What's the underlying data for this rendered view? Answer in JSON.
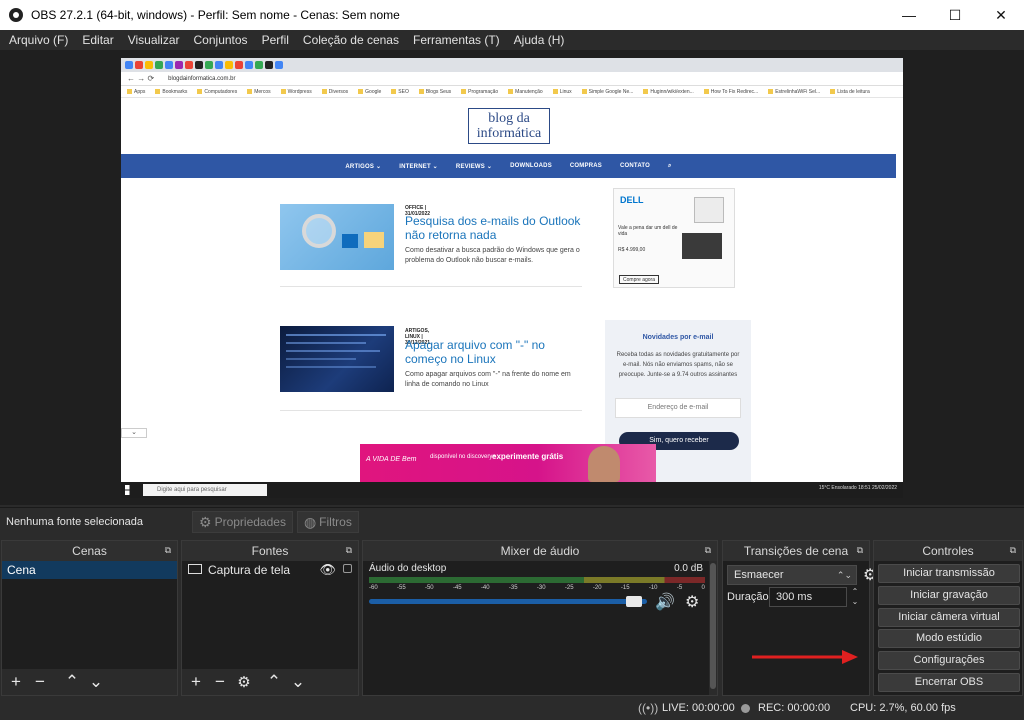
{
  "window": {
    "title": "OBS 27.2.1 (64-bit, windows) - Perfil: Sem nome - Cenas: Sem nome",
    "minimize": "—",
    "maximize": "☐",
    "close": "✕"
  },
  "menu": [
    "Arquivo (F)",
    "Editar",
    "Visualizar",
    "Conjuntos",
    "Perfil",
    "Coleção de cenas",
    "Ferramentas (T)",
    "Ajuda (H)"
  ],
  "preview": {
    "url": "blogdainformatica.com.br",
    "bookmarks": [
      "Apps",
      "Bookmarks",
      "Computadores",
      "Mercos",
      "Wordpress",
      "Diversos",
      "Google",
      "SEO",
      "Blogs Seus",
      "Programação",
      "Manutenção",
      "Linux",
      "Simple Google Ne...",
      "Huginn/wiki/exten...",
      "How To Fix Redirec...",
      "EstrelinhaWiFi Sel...",
      "Lista de leitura"
    ],
    "site_logo_line1": "blog da",
    "site_logo_line2": "informática",
    "site_nav": [
      "ARTIGOS ⌄",
      "INTERNET ⌄",
      "REVIEWS ⌄",
      "DOWNLOADS",
      "COMPRAS",
      "CONTATO",
      "⌕"
    ],
    "posts": [
      {
        "category": "OFFICE | 31/01/2022",
        "title": "Pesquisa dos e-mails do Outlook não retorna nada",
        "excerpt": "Como desativar a busca padrão do Windows que gera o problema do Outlook não buscar e-mails."
      },
      {
        "category": "ARTIGOS, LINUX | 30/12/2021",
        "title": "Apagar arquivo com \"-\" no começo no Linux",
        "excerpt": "Como apagar arquivos com \"-\" na frente do nome em linha de comando no Linux"
      }
    ],
    "ad": {
      "brand": "DELL",
      "text": "Vale a pena dar um dell de vida",
      "price": "R$ 4.999,00",
      "button": "Compre agora"
    },
    "newsletter": {
      "title": "Novidades por e-mail",
      "text": "Receba todas as novidades gratuitamente por e-mail. Nós não enviamos spams, não se preocupe. Junte-se a 9.74 outros assinantes",
      "placeholder": "Endereço de e-mail",
      "button": "Sim, quero receber"
    },
    "promo": {
      "brand": "A VIDA DE Bem",
      "sub": "disponível no discovery+",
      "cta": "experimente grátis"
    },
    "taskbar": {
      "search": "Digite aqui para pesquisar",
      "tray": "15°C Ensolarado   18:51  25/02/2022"
    }
  },
  "source_toolbar": {
    "no_source": "Nenhuma fonte selecionada",
    "properties": "Propriedades",
    "filters": "Filtros"
  },
  "docks": {
    "scenes": {
      "title": "Cenas",
      "items": [
        "Cena"
      ]
    },
    "sources": {
      "title": "Fontes",
      "items": [
        "Captura de tela"
      ]
    },
    "mixer": {
      "title": "Mixer de áudio",
      "channel": "Áudio do desktop",
      "db": "0.0 dB",
      "scale": [
        "-60",
        "-55",
        "-50",
        "-45",
        "-40",
        "-35",
        "-30",
        "-25",
        "-20",
        "-15",
        "-10",
        "-5",
        "0"
      ],
      "volume": 0.96
    },
    "transitions": {
      "title": "Transições de cena",
      "selected": "Esmaecer",
      "duration_label": "Duração",
      "duration": "300 ms"
    },
    "controls": {
      "title": "Controles",
      "buttons": [
        "Iniciar transmissão",
        "Iniciar gravação",
        "Iniciar câmera virtual",
        "Modo estúdio",
        "Configurações",
        "Encerrar OBS"
      ]
    }
  },
  "status": {
    "live": "LIVE: 00:00:00",
    "rec": "REC: 00:00:00",
    "cpu": "CPU: 2.7%, 60.00 fps"
  },
  "colors": {
    "accent_arrow": "#e02020",
    "selected_scene": "#123a5e",
    "site_nav": "#2f57a5"
  }
}
